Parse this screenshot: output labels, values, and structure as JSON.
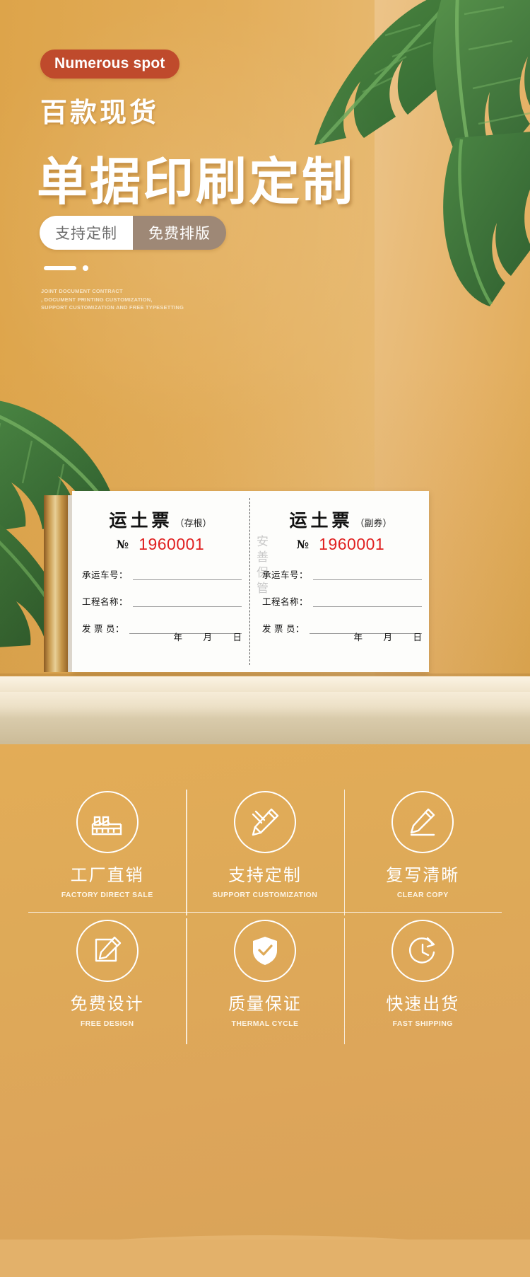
{
  "hero": {
    "badge": "Numerous spot",
    "subtitle_cn": "百款现货",
    "title_cn": "单据印刷定制",
    "pill_light": "支持定制",
    "pill_dark": "免费排版",
    "english_lines": [
      "JOINT DOCUMENT CONTRACT",
      ", DOCUMENT PRINTING CUSTOMIZATION,",
      "SUPPORT CUSTOMIZATION AND FREE TYPESETTING"
    ],
    "colors": {
      "badge_bg": "#bf4a2c",
      "pill_light_bg": "#ffffff",
      "pill_dark_bg": "#9e8876",
      "background": "#e2aa56",
      "leaf_green": "#3f7a3a"
    }
  },
  "ticket": {
    "vertical_note": "安善保管",
    "left": {
      "title": "运土票",
      "title_suffix": "（存根）",
      "no_label": "№",
      "no_value": "1960001",
      "rows": [
        "承运车号：",
        "工程名称：",
        "发 票 员："
      ],
      "date": {
        "year": "年",
        "month": "月",
        "day": "日"
      }
    },
    "right": {
      "title": "运土票",
      "title_suffix": "（副券）",
      "no_label": "№",
      "no_value": "1960001",
      "rows": [
        "承运车号：",
        "工程名称：",
        "发 票 员："
      ],
      "date": {
        "year": "年",
        "month": "月",
        "day": "日"
      }
    },
    "colors": {
      "number_red": "#e02020",
      "paper": "#fdfdfb",
      "spine": "#c89a4e"
    }
  },
  "features": {
    "row1": [
      {
        "icon": "factory-icon",
        "cn": "工厂直销",
        "en": "FACTORY DIRECT SALE"
      },
      {
        "icon": "pencil-ruler-icon",
        "cn": "支持定制",
        "en": "SUPPORT CUSTOMIZATION"
      },
      {
        "icon": "pen-write-icon",
        "cn": "复写清晰",
        "en": "CLEAR COPY"
      }
    ],
    "row2": [
      {
        "icon": "design-edit-icon",
        "cn": "免费设计",
        "en": "FREE DESIGN"
      },
      {
        "icon": "shield-check-icon",
        "cn": "质量保证",
        "en": "THERMAL CYCLE"
      },
      {
        "icon": "clock-fast-icon",
        "cn": "快速出货",
        "en": "FAST SHIPPING"
      }
    ]
  }
}
